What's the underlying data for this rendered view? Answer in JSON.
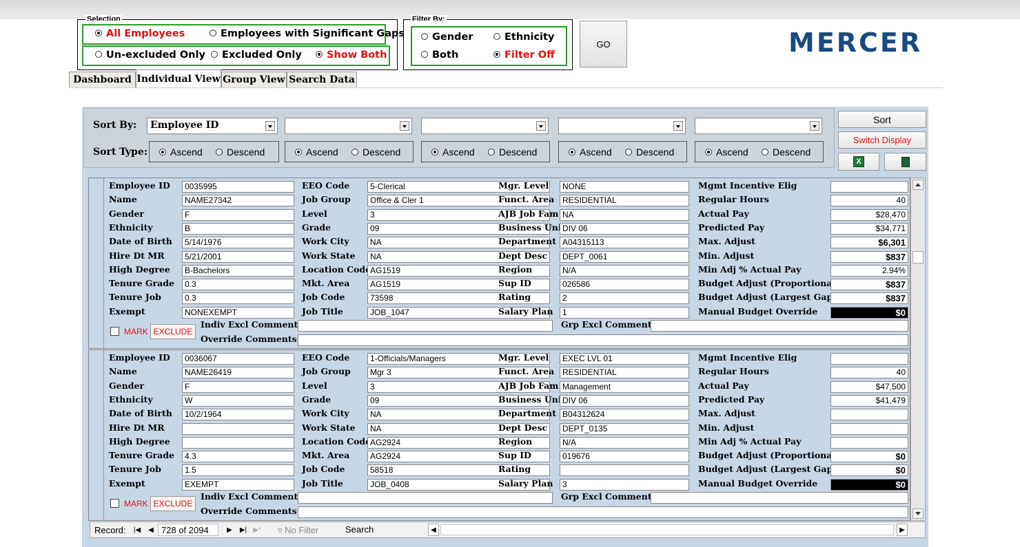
{
  "filters": {
    "frame1_legend": "Selection",
    "frame2_legend": "Filter By:",
    "all_employees": "All Employees",
    "significant_gaps": "Employees with Significant Gaps",
    "unexcluded": "Un-excluded Only",
    "excluded": "Excluded Only",
    "show_both": "Show Both",
    "gender": "Gender",
    "ethnicity": "Ethnicity",
    "both": "Both",
    "filter_off": "Filter Off",
    "go": "GO"
  },
  "brand": {
    "logo": "MERCER",
    "color": "#1a4a80"
  },
  "tabs": [
    "Dashboard",
    "Individual View",
    "Group View",
    "Search Data"
  ],
  "sort": {
    "sort_by_label": "Sort By:",
    "sort_type_label": "Sort Type:",
    "field1": "Employee ID",
    "ascend": "Ascend",
    "descend": "Descend",
    "sort_button": "Sort",
    "switch_display": "Switch Display"
  },
  "labels": {
    "c1": [
      "Employee ID",
      "Name",
      "Gender",
      "Ethnicity",
      "Date of Birth",
      "Hire Dt MR",
      "High Degree",
      "Tenure Grade",
      "Tenure Job",
      "Exempt"
    ],
    "c2": [
      "EEO Code",
      "Job Group",
      "Level",
      "Grade",
      "Work City",
      "Work State",
      "Location Code",
      "Mkt. Area",
      "Job Code",
      "Job Title"
    ],
    "c3": [
      "Mgr. Level",
      "Funct. Area",
      "AJB Job Fam",
      "Business Unit",
      "Department",
      "Dept Desc",
      "Region",
      "Sup ID",
      "Rating",
      "Salary Plan"
    ],
    "c4": [
      "Mgmt Incentive Elig",
      "Regular Hours",
      "Actual Pay",
      "Predicted Pay",
      "Max. Adjust",
      "Min. Adjust",
      "Min Adj % Actual Pay",
      "Budget Adjust (Proportional)",
      "Budget Adjust (Largest Gap)",
      "Manual Budget Override"
    ],
    "mark": "MARK",
    "exclude": "EXCLUDE",
    "indiv_excl": "Indiv Excl Comment:",
    "override": "Override Comments",
    "grp_excl": "Grp Excl Comment:"
  },
  "records": [
    {
      "c1": [
        "0035995",
        "NAME27342",
        "F",
        "B",
        "5/14/1976",
        "5/21/2001",
        "B-Bachelors",
        "0.3",
        "0.3",
        "NONEXEMPT"
      ],
      "c2": [
        "5-Clerical",
        "Office & Cler 1",
        "3",
        "09",
        "NA",
        "NA",
        "AG1519",
        "AG1519",
        "73598",
        "JOB_1047"
      ],
      "c3": [
        "NONE",
        "RESIDENTIAL",
        "NA",
        "DIV 06",
        "A04315113",
        "DEPT_0061",
        "N/A",
        "026586",
        "2",
        "1"
      ],
      "c4": [
        "",
        "40",
        "$28,470",
        "$34,771",
        "$6,301",
        "$837",
        "2.94%",
        "$837",
        "$837",
        "$0"
      ]
    },
    {
      "c1": [
        "0036067",
        "NAME26419",
        "F",
        "W",
        "10/2/1964",
        "",
        "",
        "4.3",
        "1.5",
        "EXEMPT"
      ],
      "c2": [
        "1-Officials/Managers",
        "Mgr 3",
        "3",
        "09",
        "NA",
        "NA",
        "AG2924",
        "AG2924",
        "58518",
        "JOB_0408"
      ],
      "c3": [
        "EXEC LVL 01",
        "RESIDENTIAL",
        "Management",
        "DIV 06",
        "B04312624",
        "DEPT_0135",
        "N/A",
        "019676",
        "",
        "3"
      ],
      "c4": [
        "",
        "40",
        "$47,500",
        "$41,479",
        "",
        "",
        "",
        "$0",
        "$0",
        "$0"
      ]
    }
  ],
  "navigator": {
    "record_label": "Record:",
    "position": "728 of 2094",
    "no_filter": "No Filter",
    "search": "Search"
  }
}
